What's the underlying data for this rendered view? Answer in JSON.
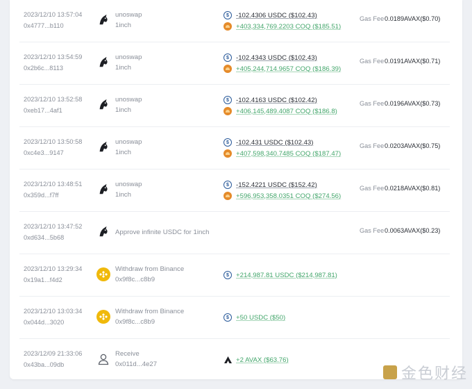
{
  "transactions": [
    {
      "time": "2023/12/10 13:57:04",
      "hash": "0x4777...b110",
      "app_type": "unoswap",
      "app_line1": "unoswap",
      "app_line2": "1inch",
      "out": "-102.4306 USDC ($102.43)",
      "in": "+403,334,769.2203 COQ ($185.51)",
      "gas_label": "Gas Fee",
      "gas": "0.0189AVAX($0.70)"
    },
    {
      "time": "2023/12/10 13:54:59",
      "hash": "0x2b6c...8113",
      "app_type": "unoswap",
      "app_line1": "unoswap",
      "app_line2": "1inch",
      "out": "-102.4343 USDC ($102.43)",
      "in": "+405,244,714.9657 COQ ($186.39)",
      "gas_label": "Gas Fee",
      "gas": "0.0191AVAX($0.71)"
    },
    {
      "time": "2023/12/10 13:52:58",
      "hash": "0xeb17...4af1",
      "app_type": "unoswap",
      "app_line1": "unoswap",
      "app_line2": "1inch",
      "out": "-102.4163 USDC ($102.42)",
      "in": "+406,145,489.4087 COQ ($186.8)",
      "gas_label": "Gas Fee",
      "gas": "0.0196AVAX($0.73)"
    },
    {
      "time": "2023/12/10 13:50:58",
      "hash": "0xc4e3...9147",
      "app_type": "unoswap",
      "app_line1": "unoswap",
      "app_line2": "1inch",
      "out": "-102.431 USDC ($102.43)",
      "in": "+407,598,340.7485 COQ ($187.47)",
      "gas_label": "Gas Fee",
      "gas": "0.0203AVAX($0.75)"
    },
    {
      "time": "2023/12/10 13:48:51",
      "hash": "0x359d...f7ff",
      "app_type": "unoswap",
      "app_line1": "unoswap",
      "app_line2": "1inch",
      "out": "-152.4221 USDC ($152.42)",
      "in": "+596,953,358.0351 COQ ($274.56)",
      "gas_label": "Gas Fee",
      "gas": "0.0218AVAX($0.81)"
    },
    {
      "time": "2023/12/10 13:47:52",
      "hash": "0xd634...5b68",
      "app_type": "approve",
      "app_single": "Approve infinite USDC for 1inch",
      "gas_label": "Gas Fee",
      "gas": "0.0063AVAX($0.23)"
    },
    {
      "time": "2023/12/10 13:29:34",
      "hash": "0x19a1...f4d2",
      "app_type": "binance",
      "app_line1": "Withdraw from Binance",
      "app_line2": "0x9f8c...c8b9",
      "in_usdc": "+214,987.81 USDC ($214,987.81)"
    },
    {
      "time": "2023/12/10 13:03:34",
      "hash": "0x044d...3020",
      "app_type": "binance",
      "app_line1": "Withdraw from Binance",
      "app_line2": "0x9f8c...c8b9",
      "in_usdc": "+50 USDC ($50)"
    },
    {
      "time": "2023/12/09 21:33:06",
      "hash": "0x43ba...09db",
      "app_type": "receive",
      "app_line1": "Receive",
      "app_line2": "0x011d...4e27",
      "in_avax": "+2 AVAX ($63.76)"
    }
  ],
  "watermark": {
    "text": "金色财经"
  },
  "colors": {
    "positive": "#43a66b",
    "usdc": "#2a5a9a",
    "coq": "#e58b2a",
    "binance": "#f0b90b"
  }
}
